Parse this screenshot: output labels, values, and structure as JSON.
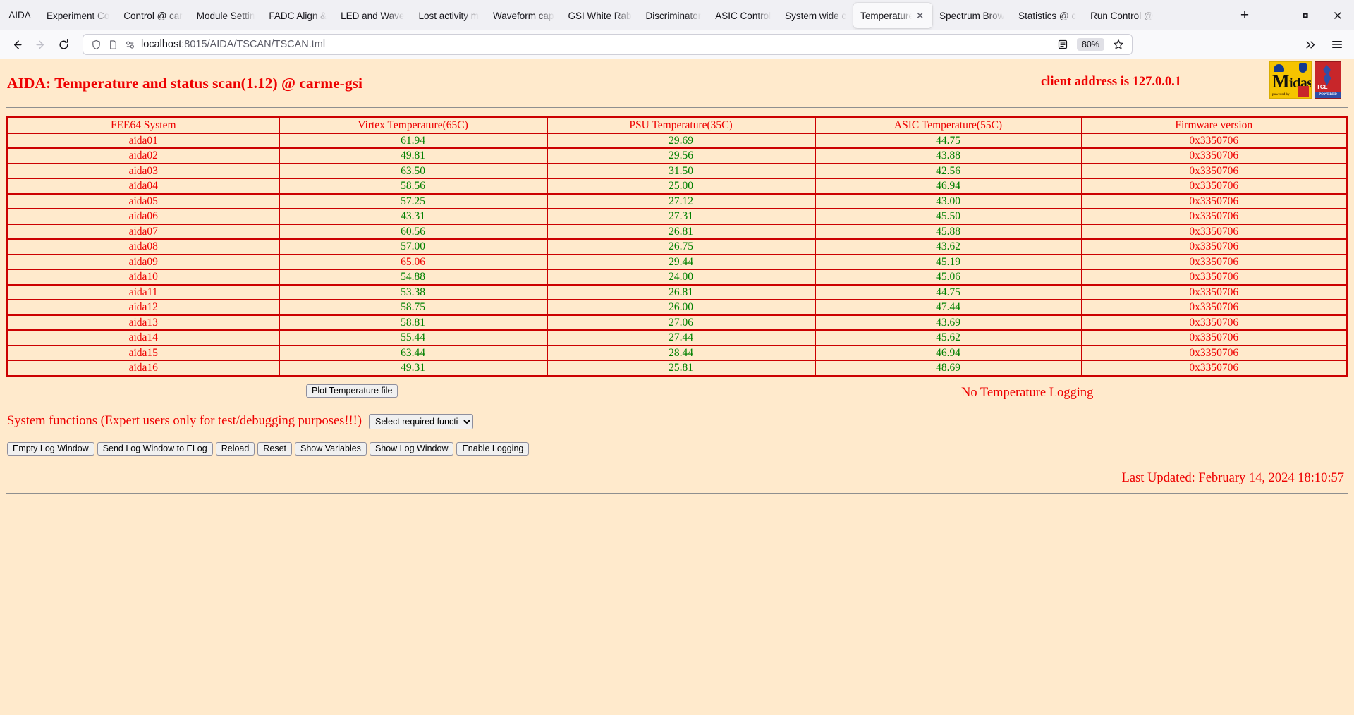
{
  "browser": {
    "home_label": "AIDA",
    "tabs": [
      {
        "label": "Experiment Co",
        "active": false
      },
      {
        "label": "Control @ car",
        "active": false
      },
      {
        "label": "Module Settin",
        "active": false
      },
      {
        "label": "FADC Align &",
        "active": false
      },
      {
        "label": "LED and Wave",
        "active": false
      },
      {
        "label": "Lost activity m",
        "active": false
      },
      {
        "label": "Waveform cap",
        "active": false
      },
      {
        "label": "GSI White Rab",
        "active": false
      },
      {
        "label": "Discriminator",
        "active": false
      },
      {
        "label": "ASIC Control",
        "active": false
      },
      {
        "label": "System wide c",
        "active": false
      },
      {
        "label": "Temperature",
        "active": true
      },
      {
        "label": "Spectrum Brow",
        "active": false
      },
      {
        "label": "Statistics @ c",
        "active": false
      },
      {
        "label": "Run Control @",
        "active": false
      }
    ],
    "new_tab_label": "+",
    "url_host": "localhost",
    "url_path": ":8015/AIDA/TSCAN/TSCAN.tml",
    "zoom_level": "80%",
    "window_minimize": "minimize-icon",
    "window_maximize": "maximize-icon",
    "window_close": "close-icon"
  },
  "page": {
    "title": "AIDA: Temperature and status scan(1.12) @ carme-gsi",
    "client_address": "client address is 127.0.0.1",
    "logo_midas_text": "idas",
    "logo_midas_initial": "M",
    "logo_midas_sub": "powered by",
    "logo_tcl_text": "TCL",
    "logo_tcl_bar": "POWERED"
  },
  "table": {
    "headers": [
      "FEE64 System",
      "Virtex Temperature(65C)",
      "PSU Temperature(35C)",
      "ASIC Temperature(55C)",
      "Firmware version"
    ],
    "rows": [
      {
        "system": "aida01",
        "virtex": "61.94",
        "virtex_alarm": false,
        "psu": "29.69",
        "psu_alarm": false,
        "asic": "44.75",
        "asic_alarm": false,
        "firmware": "0x3350706"
      },
      {
        "system": "aida02",
        "virtex": "49.81",
        "virtex_alarm": false,
        "psu": "29.56",
        "psu_alarm": false,
        "asic": "43.88",
        "asic_alarm": false,
        "firmware": "0x3350706"
      },
      {
        "system": "aida03",
        "virtex": "63.50",
        "virtex_alarm": false,
        "psu": "31.50",
        "psu_alarm": false,
        "asic": "42.56",
        "asic_alarm": false,
        "firmware": "0x3350706"
      },
      {
        "system": "aida04",
        "virtex": "58.56",
        "virtex_alarm": false,
        "psu": "25.00",
        "psu_alarm": false,
        "asic": "46.94",
        "asic_alarm": false,
        "firmware": "0x3350706"
      },
      {
        "system": "aida05",
        "virtex": "57.25",
        "virtex_alarm": false,
        "psu": "27.12",
        "psu_alarm": false,
        "asic": "43.00",
        "asic_alarm": false,
        "firmware": "0x3350706"
      },
      {
        "system": "aida06",
        "virtex": "43.31",
        "virtex_alarm": false,
        "psu": "27.31",
        "psu_alarm": false,
        "asic": "45.50",
        "asic_alarm": false,
        "firmware": "0x3350706"
      },
      {
        "system": "aida07",
        "virtex": "60.56",
        "virtex_alarm": false,
        "psu": "26.81",
        "psu_alarm": false,
        "asic": "45.88",
        "asic_alarm": false,
        "firmware": "0x3350706"
      },
      {
        "system": "aida08",
        "virtex": "57.00",
        "virtex_alarm": false,
        "psu": "26.75",
        "psu_alarm": false,
        "asic": "43.62",
        "asic_alarm": false,
        "firmware": "0x3350706"
      },
      {
        "system": "aida09",
        "virtex": "65.06",
        "virtex_alarm": true,
        "psu": "29.44",
        "psu_alarm": false,
        "asic": "45.19",
        "asic_alarm": false,
        "firmware": "0x3350706"
      },
      {
        "system": "aida10",
        "virtex": "54.88",
        "virtex_alarm": false,
        "psu": "24.00",
        "psu_alarm": false,
        "asic": "45.06",
        "asic_alarm": false,
        "firmware": "0x3350706"
      },
      {
        "system": "aida11",
        "virtex": "53.38",
        "virtex_alarm": false,
        "psu": "26.81",
        "psu_alarm": false,
        "asic": "44.75",
        "asic_alarm": false,
        "firmware": "0x3350706"
      },
      {
        "system": "aida12",
        "virtex": "58.75",
        "virtex_alarm": false,
        "psu": "26.00",
        "psu_alarm": false,
        "asic": "47.44",
        "asic_alarm": false,
        "firmware": "0x3350706"
      },
      {
        "system": "aida13",
        "virtex": "58.81",
        "virtex_alarm": false,
        "psu": "27.06",
        "psu_alarm": false,
        "asic": "43.69",
        "asic_alarm": false,
        "firmware": "0x3350706"
      },
      {
        "system": "aida14",
        "virtex": "55.44",
        "virtex_alarm": false,
        "psu": "27.44",
        "psu_alarm": false,
        "asic": "45.62",
        "asic_alarm": false,
        "firmware": "0x3350706"
      },
      {
        "system": "aida15",
        "virtex": "63.44",
        "virtex_alarm": false,
        "psu": "28.44",
        "psu_alarm": false,
        "asic": "46.94",
        "asic_alarm": false,
        "firmware": "0x3350706"
      },
      {
        "system": "aida16",
        "virtex": "49.31",
        "virtex_alarm": false,
        "psu": "25.81",
        "psu_alarm": false,
        "asic": "48.69",
        "asic_alarm": false,
        "firmware": "0x3350706"
      }
    ]
  },
  "controls": {
    "plot_button": "Plot Temperature file",
    "logging_status": "No Temperature Logging",
    "system_functions_label": "System functions (Expert users only for test/debugging purposes!!!)",
    "select_placeholder": "Select required function",
    "buttons": [
      "Empty Log Window",
      "Send Log Window to ELog",
      "Reload",
      "Reset",
      "Show Variables",
      "Show Log Window",
      "Enable Logging"
    ]
  },
  "footer": {
    "last_updated": "Last Updated: February 14, 2024 18:10:57"
  },
  "colors": {
    "page_background": "#ffeacc",
    "accent_red": "#ee0000",
    "border_red": "#cc0000",
    "value_green": "#008000"
  }
}
